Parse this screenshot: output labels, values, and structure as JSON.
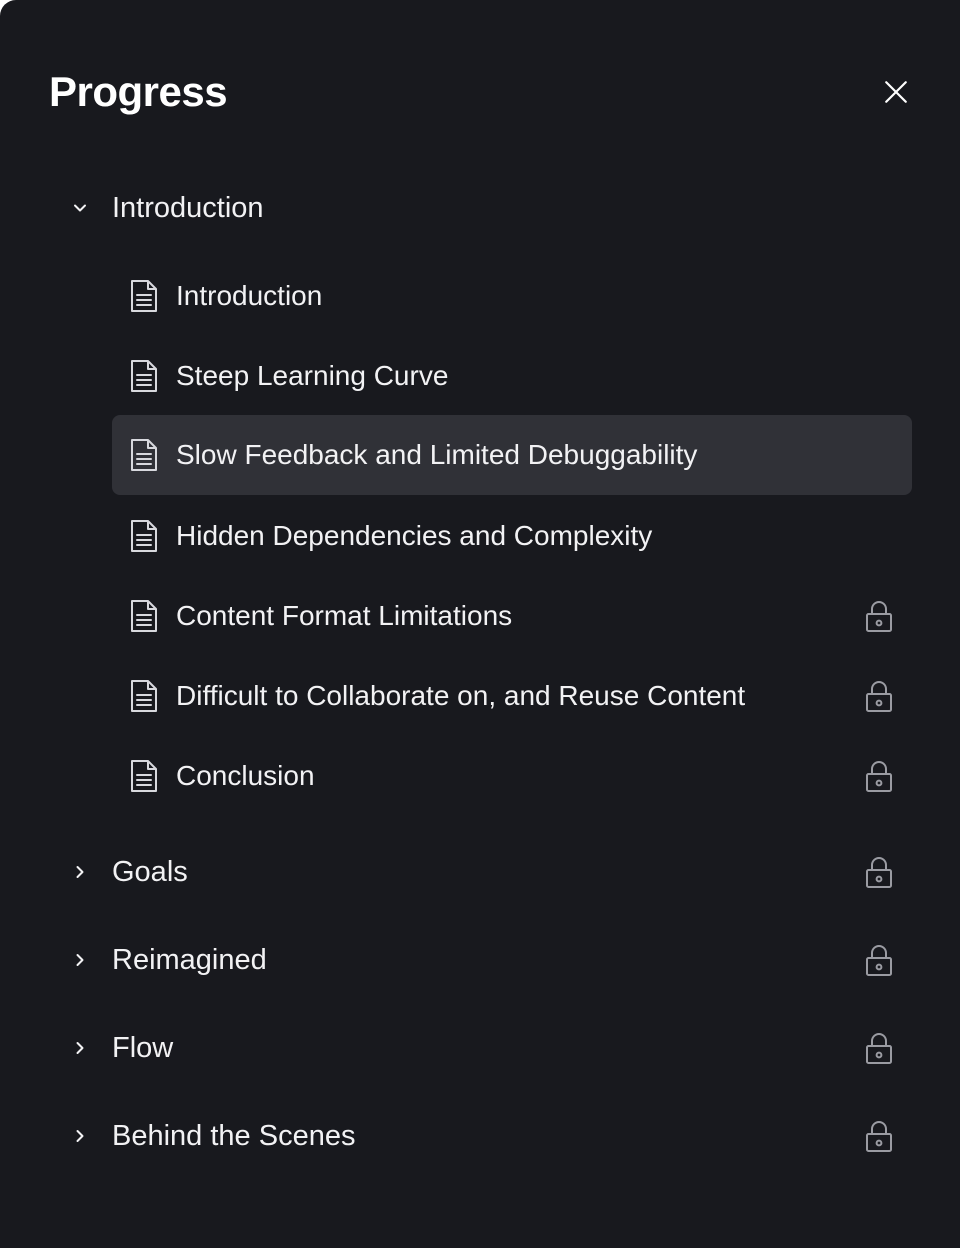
{
  "header": {
    "title": "Progress",
    "close_icon": "close-icon"
  },
  "colors": {
    "background": "#18191e",
    "active_row": "#303137",
    "text": "#f2f2f4",
    "icon": "#d8d9de",
    "lock": "#9a9ba2"
  },
  "sections": [
    {
      "label": "Introduction",
      "expanded": true,
      "locked": false,
      "lessons": [
        {
          "label": "Introduction",
          "locked": false,
          "active": false
        },
        {
          "label": "Steep Learning Curve",
          "locked": false,
          "active": false
        },
        {
          "label": "Slow Feedback and Limited Debuggability",
          "locked": false,
          "active": true
        },
        {
          "label": "Hidden Dependencies and Complexity",
          "locked": false,
          "active": false
        },
        {
          "label": "Content Format Limitations",
          "locked": true,
          "active": false
        },
        {
          "label": "Difficult to Collaborate on, and Reuse Content",
          "locked": true,
          "active": false
        },
        {
          "label": "Conclusion",
          "locked": true,
          "active": false
        }
      ]
    },
    {
      "label": "Goals",
      "expanded": false,
      "locked": true
    },
    {
      "label": "Reimagined",
      "expanded": false,
      "locked": true
    },
    {
      "label": "Flow",
      "expanded": false,
      "locked": true
    },
    {
      "label": "Behind the Scenes",
      "expanded": false,
      "locked": true
    }
  ]
}
